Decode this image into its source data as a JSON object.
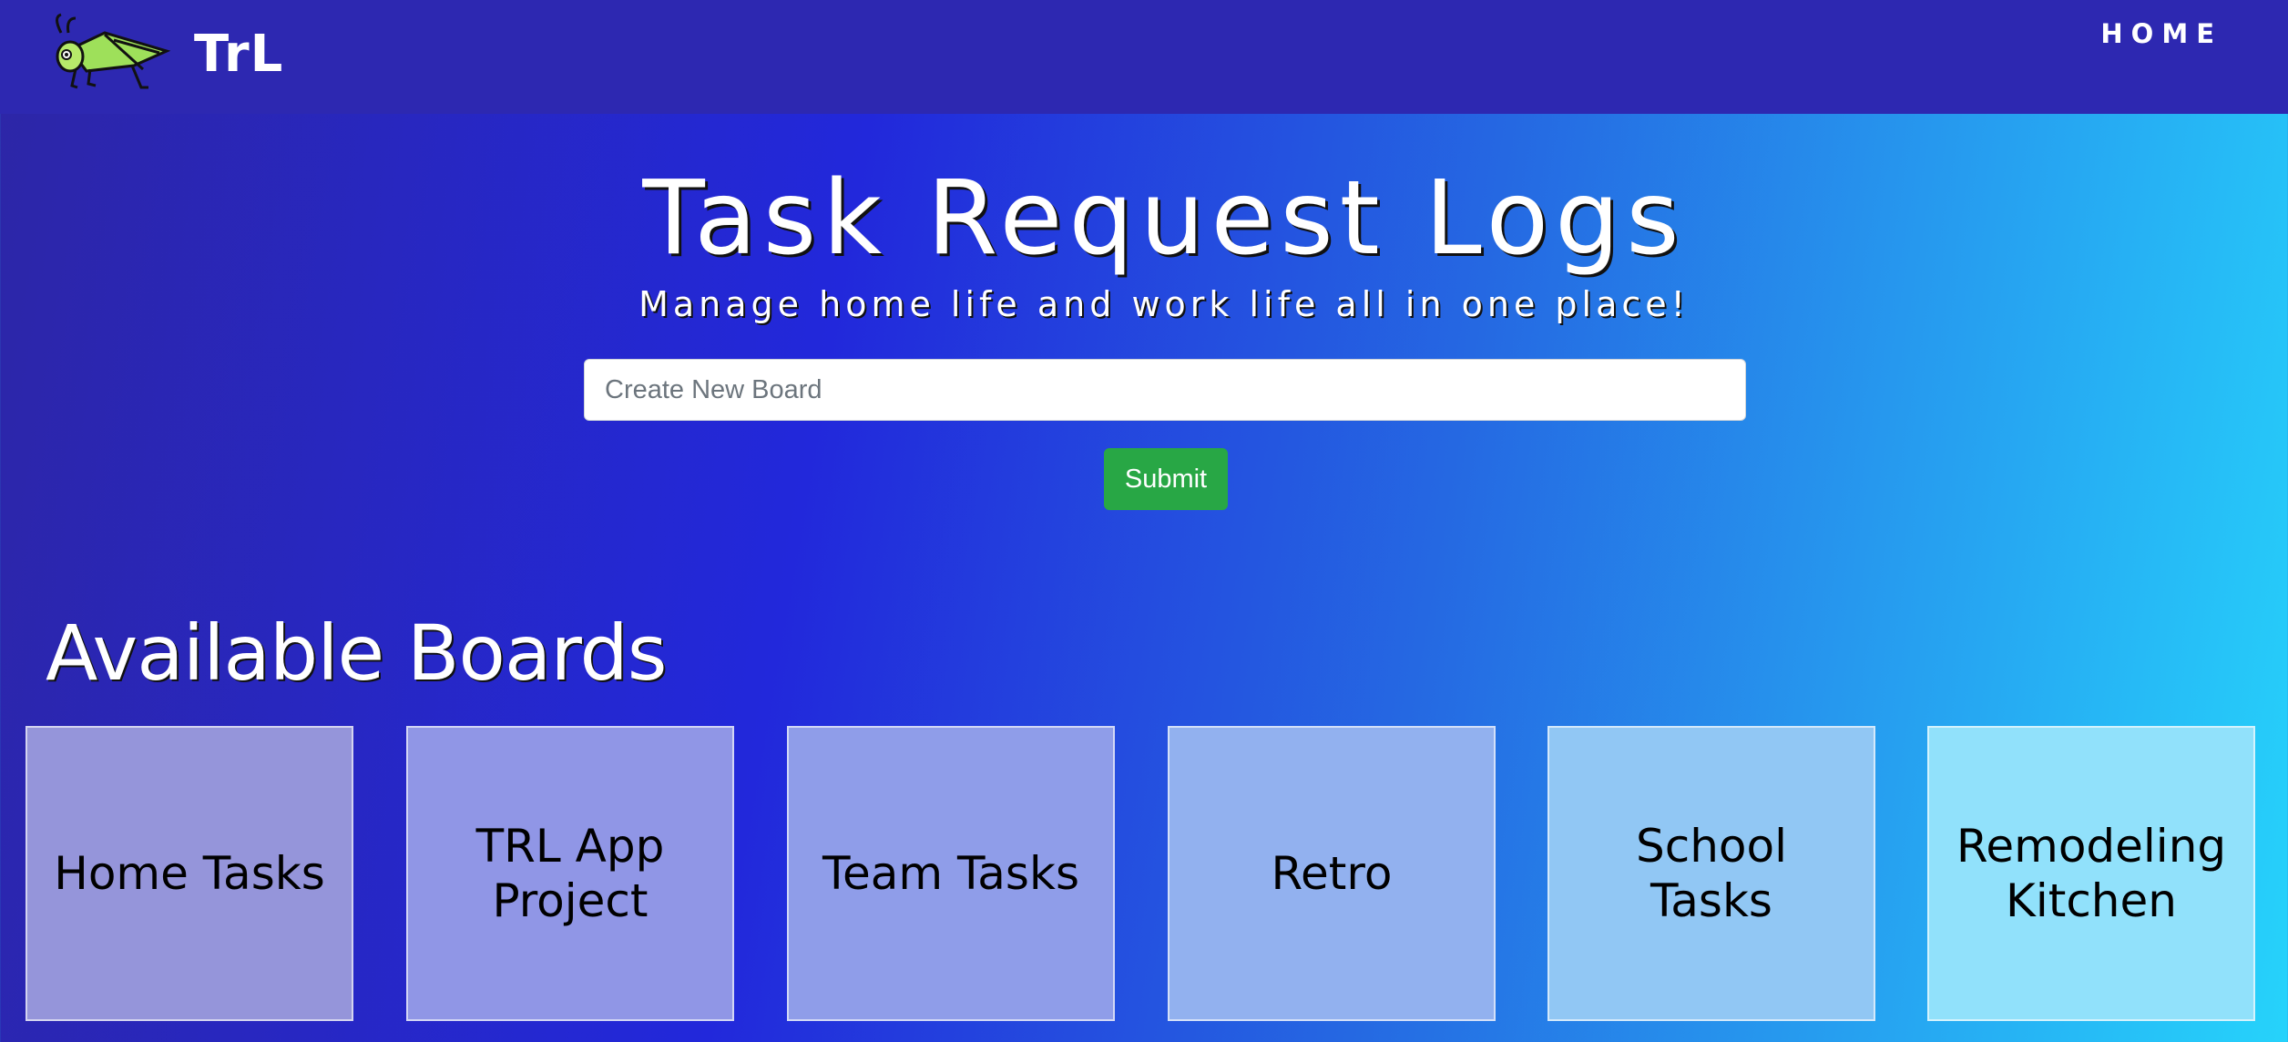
{
  "navbar": {
    "brand_text": "TrL",
    "logo_icon": "grasshopper-icon",
    "home_label": "HOME"
  },
  "hero": {
    "title": "Task Request Logs",
    "subtitle": "Manage home life and work life all in one place!"
  },
  "create_board": {
    "placeholder": "Create New Board",
    "value": "",
    "submit_label": "Submit"
  },
  "boards_section": {
    "title": "Available Boards",
    "boards": [
      {
        "label": "Home Tasks"
      },
      {
        "label": "TRL App Project"
      },
      {
        "label": "Team Tasks"
      },
      {
        "label": "Retro"
      },
      {
        "label": "School Tasks"
      },
      {
        "label": "Remodeling Kitchen"
      }
    ]
  },
  "colors": {
    "navbar": "#2d28b1",
    "submit": "#28a745",
    "gradient_start": "#2d26a6",
    "gradient_end": "#26d3fb"
  }
}
